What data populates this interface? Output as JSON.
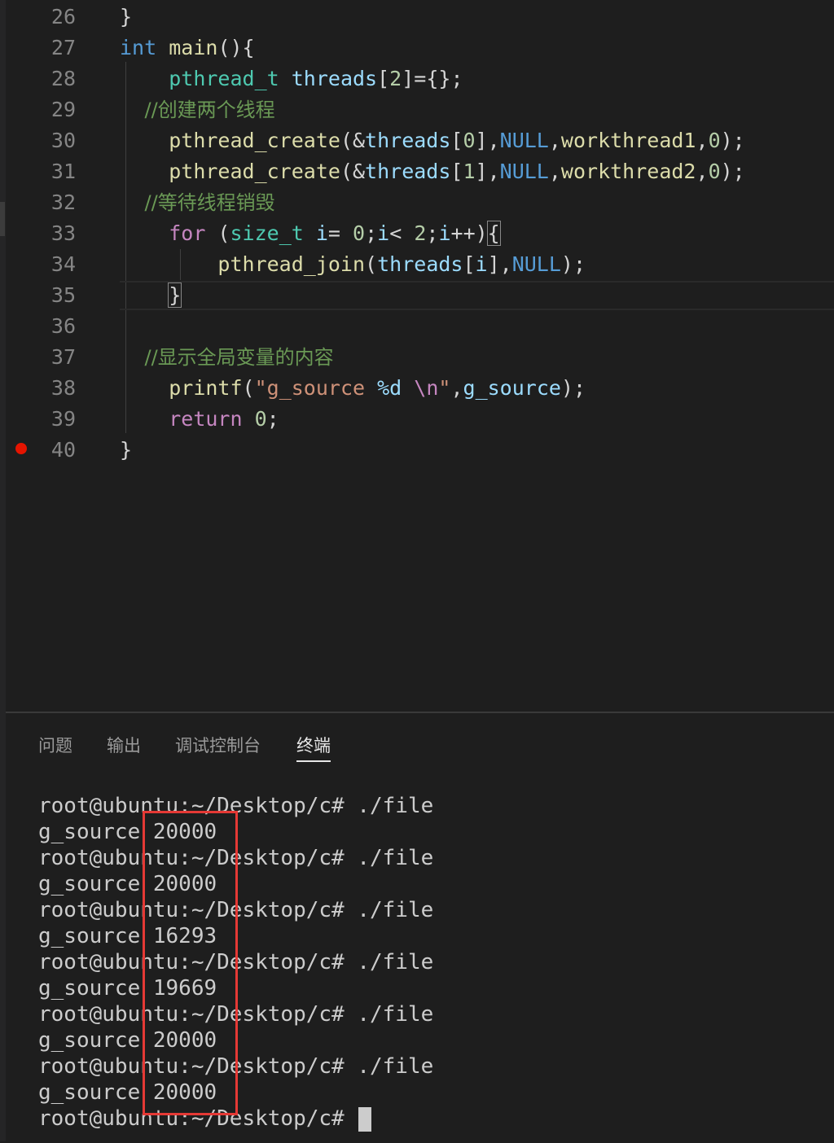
{
  "editor": {
    "lines": [
      {
        "n": "26",
        "text": "}"
      },
      {
        "n": "27",
        "text": "int main(){"
      },
      {
        "n": "28",
        "text": "    pthread_t threads[2]={};"
      },
      {
        "n": "29",
        "text": "    //创建两个线程"
      },
      {
        "n": "30",
        "text": "    pthread_create(&threads[0],NULL,workthread1,0);"
      },
      {
        "n": "31",
        "text": "    pthread_create(&threads[1],NULL,workthread2,0);"
      },
      {
        "n": "32",
        "text": "    //等待线程销毁"
      },
      {
        "n": "33",
        "text": "    for (size_t i= 0;i< 2;i++){"
      },
      {
        "n": "34",
        "text": "        pthread_join(threads[i],NULL);"
      },
      {
        "n": "35",
        "text": "    }"
      },
      {
        "n": "36",
        "text": ""
      },
      {
        "n": "37",
        "text": "    //显示全局变量的内容"
      },
      {
        "n": "38",
        "text": "    printf(\"g_source %d \\n\",g_source);"
      },
      {
        "n": "39",
        "text": "    return 0;"
      },
      {
        "n": "40",
        "text": "}"
      }
    ],
    "breakpoint_line": "40"
  },
  "panel": {
    "tabs": [
      "问题",
      "输出",
      "调试控制台",
      "终端"
    ],
    "active_tab": "终端"
  },
  "terminal": {
    "lines": [
      "root@ubuntu:~/Desktop/c# ./file",
      "g_source 20000",
      "root@ubuntu:~/Desktop/c# ./file",
      "g_source 20000",
      "root@ubuntu:~/Desktop/c# ./file",
      "g_source 16293",
      "root@ubuntu:~/Desktop/c# ./file",
      "g_source 19669",
      "root@ubuntu:~/Desktop/c# ./file",
      "g_source 20000",
      "root@ubuntu:~/Desktop/c# ./file",
      "g_source 20000"
    ],
    "prompt": "root@ubuntu:~/Desktop/c# "
  },
  "colors": {
    "background": "#1e1e1e",
    "keyword": "#569cd6",
    "control_keyword": "#c586c0",
    "type": "#4ec9b0",
    "function": "#dcdcaa",
    "variable": "#9cdcfe",
    "comment": "#6a9955",
    "breakpoint": "#e51400",
    "highlight_box": "#e53935"
  }
}
